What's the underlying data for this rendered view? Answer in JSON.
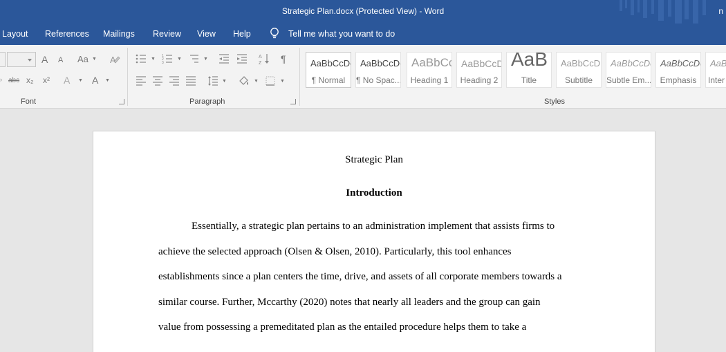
{
  "window": {
    "title": "Strategic Plan.docx (Protected View)  -  Word",
    "corner_text": "n"
  },
  "menu": {
    "tabs": [
      "Layout",
      "References",
      "Mailings",
      "Review",
      "View",
      "Help"
    ],
    "tell_me": "Tell me what you want to do"
  },
  "ribbon": {
    "groups": {
      "font": "Font",
      "paragraph": "Paragraph",
      "styles": "Styles"
    },
    "font_buttons": {
      "grow": "A",
      "shrink": "A",
      "case": "Aa",
      "strike": "abc",
      "subscript": "x₂",
      "superscript": "x²",
      "text_effects": "A",
      "font_color": "A"
    },
    "styles": [
      {
        "preview": "AaBbCcDc",
        "name": "¶ Normal"
      },
      {
        "preview": "AaBbCcDc",
        "name": "¶ No Spac..."
      },
      {
        "preview": "AaBbCc",
        "name": "Heading 1"
      },
      {
        "preview": "AaBbCcD",
        "name": "Heading 2"
      },
      {
        "preview": "AaB",
        "name": "Title"
      },
      {
        "preview": "AaBbCcD",
        "name": "Subtitle"
      },
      {
        "preview": "AaBbCcDc",
        "name": "Subtle Em..."
      },
      {
        "preview": "AaBbCcDc",
        "name": "Emphasis"
      },
      {
        "preview": "AaB",
        "name": "Inter"
      }
    ]
  },
  "document": {
    "title": "Strategic Plan",
    "heading": "Introduction",
    "lines": [
      "Essentially, a strategic plan pertains to an administration implement that assists firms to",
      "achieve the selected approach (Olsen & Olsen, 2010). Particularly, this tool enhances",
      "establishments since a plan centers the time, drive, and assets of all corporate members towards a",
      "similar course. Further, Mccarthy (2020) notes that nearly all leaders and the group can gain",
      "value from possessing a premeditated plan as the entailed procedure helps them to take a"
    ]
  },
  "colors": {
    "accent": "#2b579a",
    "ribbon_bg": "#f3f3f3",
    "doc_bg": "#e6e6e6"
  }
}
